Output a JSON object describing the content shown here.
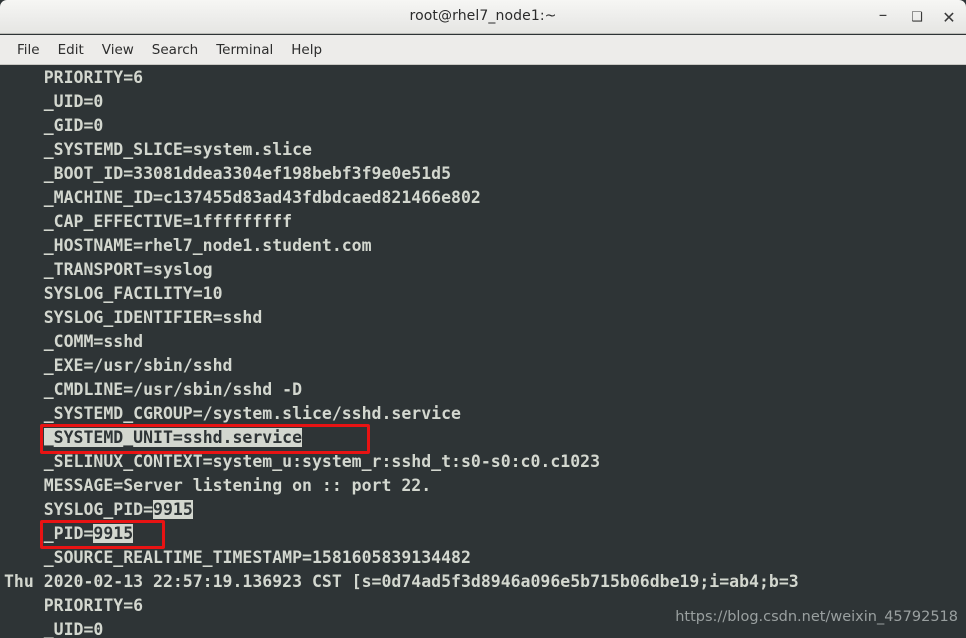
{
  "window": {
    "title": "root@rhel7_node1:~",
    "controls": {
      "minimize": "–",
      "maximize": "❑",
      "close": "✕"
    }
  },
  "menubar": {
    "items": [
      {
        "label": "File"
      },
      {
        "label": "Edit"
      },
      {
        "label": "View"
      },
      {
        "label": "Search"
      },
      {
        "label": "Terminal"
      },
      {
        "label": "Help"
      }
    ]
  },
  "terminal": {
    "lines": [
      {
        "text": "    PRIORITY=6"
      },
      {
        "text": "    _UID=0"
      },
      {
        "text": "    _GID=0"
      },
      {
        "text": "    _SYSTEMD_SLICE=system.slice"
      },
      {
        "text": "    _BOOT_ID=33081ddea3304ef198bebf3f9e0e51d5"
      },
      {
        "text": "    _MACHINE_ID=c137455d83ad43fdbdcaed821466e802"
      },
      {
        "text": "    _CAP_EFFECTIVE=1fffffffff"
      },
      {
        "text": "    _HOSTNAME=rhel7_node1.student.com"
      },
      {
        "text": "    _TRANSPORT=syslog"
      },
      {
        "text": "    SYSLOG_FACILITY=10"
      },
      {
        "text": "    SYSLOG_IDENTIFIER=sshd"
      },
      {
        "text": "    _COMM=sshd"
      },
      {
        "text": "    _EXE=/usr/sbin/sshd"
      },
      {
        "text": "    _CMDLINE=/usr/sbin/sshd -D"
      },
      {
        "text": "    _SYSTEMD_CGROUP=/system.slice/sshd.service"
      },
      {
        "prefix": "    ",
        "highlight": "_SYSTEMD_UNIT=sshd.service",
        "suffix": ""
      },
      {
        "text": "    _SELINUX_CONTEXT=system_u:system_r:sshd_t:s0-s0:c0.c1023"
      },
      {
        "text": "    MESSAGE=Server listening on :: port 22."
      },
      {
        "prefix": "    SYSLOG_PID=",
        "highlight": "9915",
        "suffix": ""
      },
      {
        "prefix": "    _PID=",
        "highlight": "9915",
        "suffix": ""
      },
      {
        "text": "    _SOURCE_REALTIME_TIMESTAMP=1581605839134482"
      },
      {
        "text": "Thu 2020-02-13 22:57:19.136923 CST [s=0d74ad5f3d8946a096e5b715b06dbe19;i=ab4;b=3"
      },
      {
        "text": "    PRIORITY=6"
      },
      {
        "text": "    _UID=0"
      }
    ]
  },
  "annotations": {
    "systemd_unit_box_color": "#e81313",
    "pid_box_color": "#e81313"
  },
  "watermark": {
    "text": "https://blog.csdn.net/weixin_45792518"
  },
  "colors": {
    "terminal_background": "#2e3436",
    "terminal_foreground": "#d3d7cf",
    "selection_background": "#d3d7cf",
    "titlebar_background": "#edecea",
    "annotation_red": "#e81313"
  }
}
